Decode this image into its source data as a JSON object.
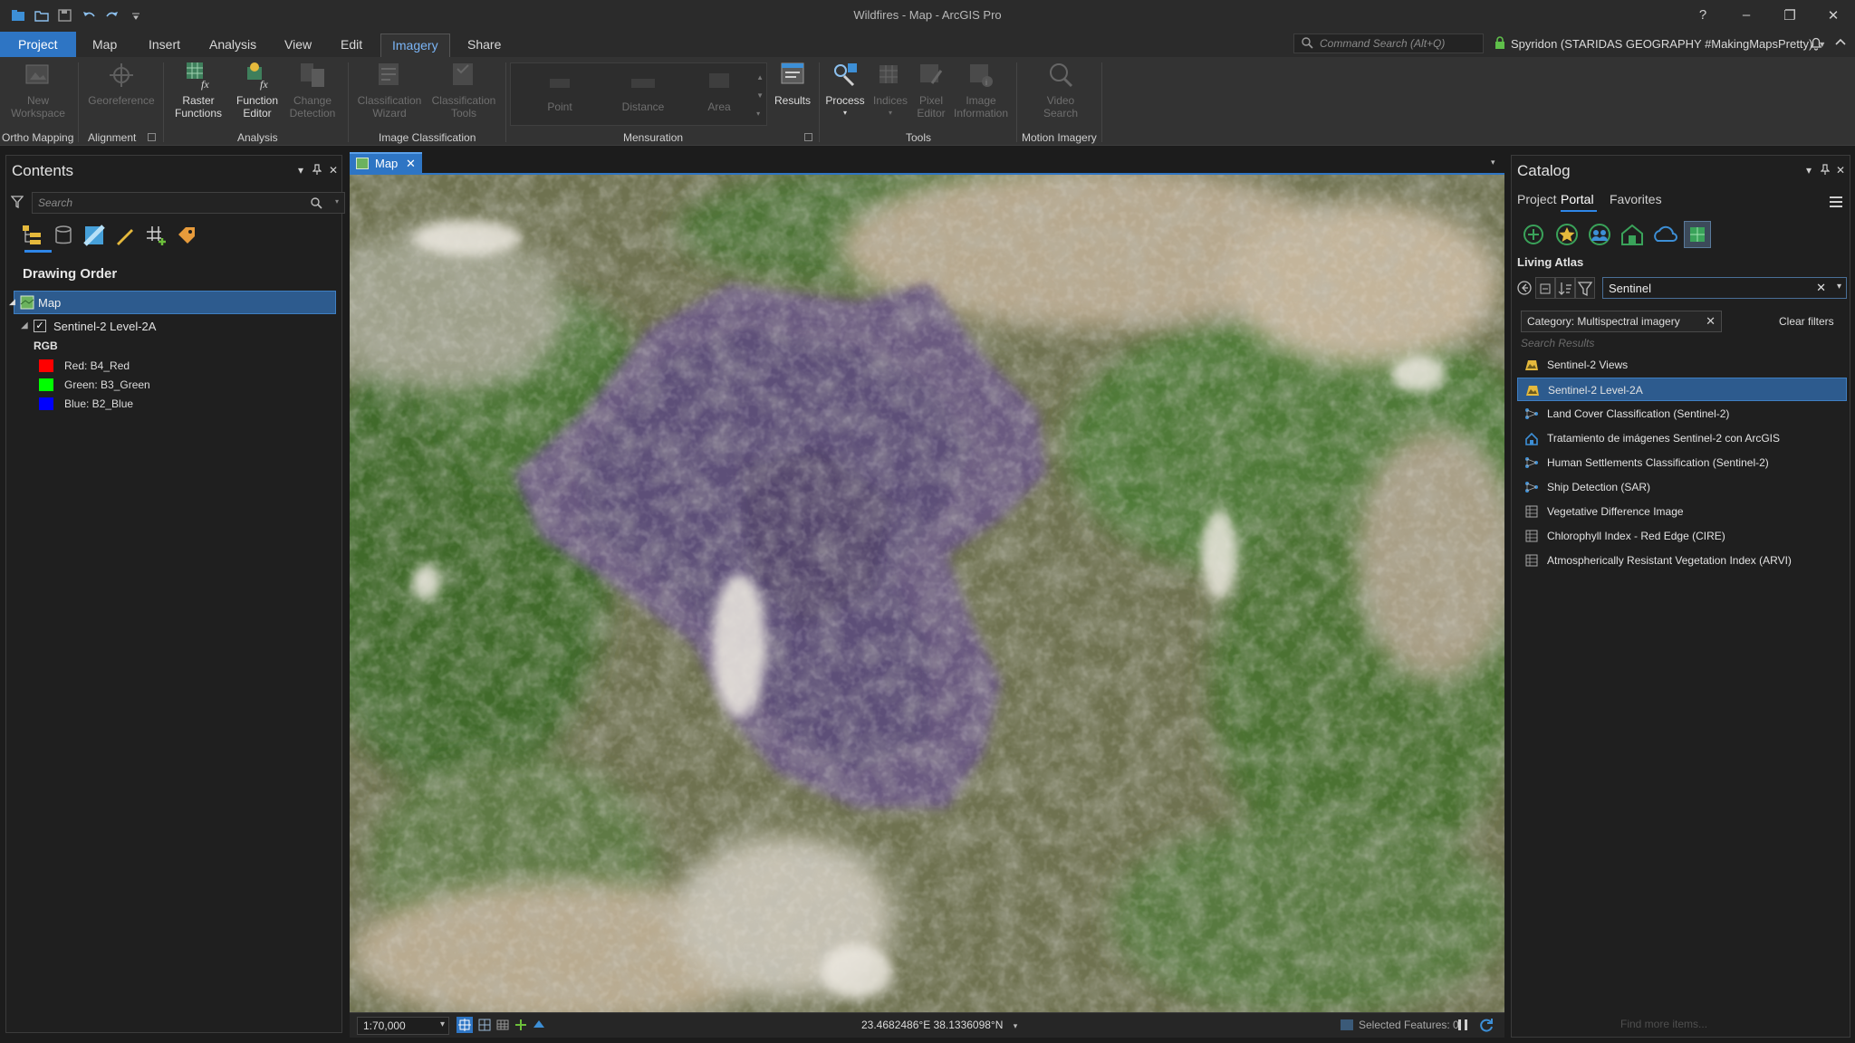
{
  "window": {
    "title": "Wildfires - Map - ArcGIS Pro",
    "help": "?",
    "minimize": "–",
    "restore": "❐",
    "close": "✕"
  },
  "ribbon_tabs": [
    "Project",
    "Map",
    "Insert",
    "Analysis",
    "View",
    "Edit",
    "Imagery",
    "Share"
  ],
  "active_tab": "Imagery",
  "command_search": {
    "placeholder": "Command Search (Alt+Q)"
  },
  "user": {
    "name": "Spyridon (STARIDAS GEOGRAPHY #MakingMapsPretty)"
  },
  "ribbon": {
    "new_workspace": "New\nWorkspace",
    "georeference": "Georeference",
    "raster_functions": "Raster\nFunctions",
    "function_editor": "Function\nEditor",
    "change_detection": "Change\nDetection",
    "classification_wizard": "Classification\nWizard",
    "classification_tools": "Classification\nTools",
    "point": "Point",
    "distance": "Distance",
    "area": "Area",
    "results": "Results",
    "process": "Process",
    "indices": "Indices",
    "pixel_editor": "Pixel\nEditor",
    "image_information": "Image\nInformation",
    "video_search": "Video\nSearch",
    "groups": {
      "ortho_mapping": "Ortho Mapping",
      "alignment": "Alignment",
      "analysis": "Analysis",
      "image_classification": "Image Classification",
      "mensuration": "Mensuration",
      "tools": "Tools",
      "motion_imagery": "Motion Imagery"
    }
  },
  "contents": {
    "title": "Contents",
    "search_placeholder": "Search",
    "drawing_order": "Drawing Order",
    "map_item": "Map",
    "layer": "Sentinel-2 Level-2A",
    "rgb": "RGB",
    "bands": [
      {
        "label": "Red:  B4_Red",
        "color": "#ff0000"
      },
      {
        "label": "Green:  B3_Green",
        "color": "#00ff00"
      },
      {
        "label": "Blue:  B2_Blue",
        "color": "#0000ff"
      }
    ]
  },
  "map_view": {
    "tab_label": "Map",
    "scale": "1:70,000",
    "coordinates": "23.4682486°E 38.1336098°N",
    "selected_features": "Selected Features: 0"
  },
  "catalog": {
    "title": "Catalog",
    "tabs": [
      "Project",
      "Portal",
      "Favorites"
    ],
    "active_tab": "Portal",
    "section": "Living Atlas",
    "search_value": "Sentinel",
    "filter_chip": "Category: Multispectral imagery",
    "clear_filters": "Clear filters",
    "results_label": "Search Results",
    "results": [
      {
        "label": "Sentinel-2 Views",
        "icon": "imagery-layer-icon"
      },
      {
        "label": "Sentinel-2 Level-2A",
        "icon": "imagery-layer-icon",
        "selected": true
      },
      {
        "label": "Land Cover Classification (Sentinel-2)",
        "icon": "deep-learning-package-icon"
      },
      {
        "label": "Tratamiento de imágenes Sentinel-2 con ArcGIS",
        "icon": "globe-web-icon"
      },
      {
        "label": "Human Settlements Classification (Sentinel-2)",
        "icon": "deep-learning-package-icon"
      },
      {
        "label": "Ship Detection (SAR)",
        "icon": "deep-learning-package-icon"
      },
      {
        "label": "Vegetative Difference Image",
        "icon": "raster-function-template-icon"
      },
      {
        "label": "Chlorophyll Index - Red Edge (CIRE)",
        "icon": "raster-function-template-icon"
      },
      {
        "label": "Atmospherically Resistant Vegetation Index (ARVI)",
        "icon": "raster-function-template-icon"
      }
    ],
    "find_more": "Find more items..."
  },
  "colors": {
    "accent": "#2e75c4",
    "selection": "#2d5b8e",
    "background": "#1f1f1f"
  }
}
